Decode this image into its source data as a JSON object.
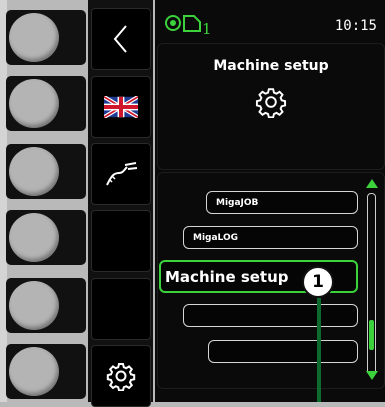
{
  "status": {
    "job_number": "1",
    "time": "10:15"
  },
  "header": {
    "title": "Machine setup",
    "icon": "gear-icon"
  },
  "side_buttons": [
    {
      "icon": "back-chevron-icon"
    },
    {
      "icon": "uk-flag-icon"
    },
    {
      "icon": "torch-cable-icon"
    },
    {
      "icon": ""
    },
    {
      "icon": ""
    },
    {
      "icon": "gear-icon"
    }
  ],
  "menu": {
    "items": [
      {
        "label": "MigaJOB"
      },
      {
        "label": "MigaLOG"
      },
      {
        "label": "Machine setup",
        "selected": true
      },
      {
        "label": ""
      },
      {
        "label": ""
      }
    ],
    "scroll_position": 0.85
  },
  "callout": {
    "number": "1"
  },
  "colors": {
    "accent_green": "#3cd23c",
    "callout_line": "#0d6b2e"
  }
}
